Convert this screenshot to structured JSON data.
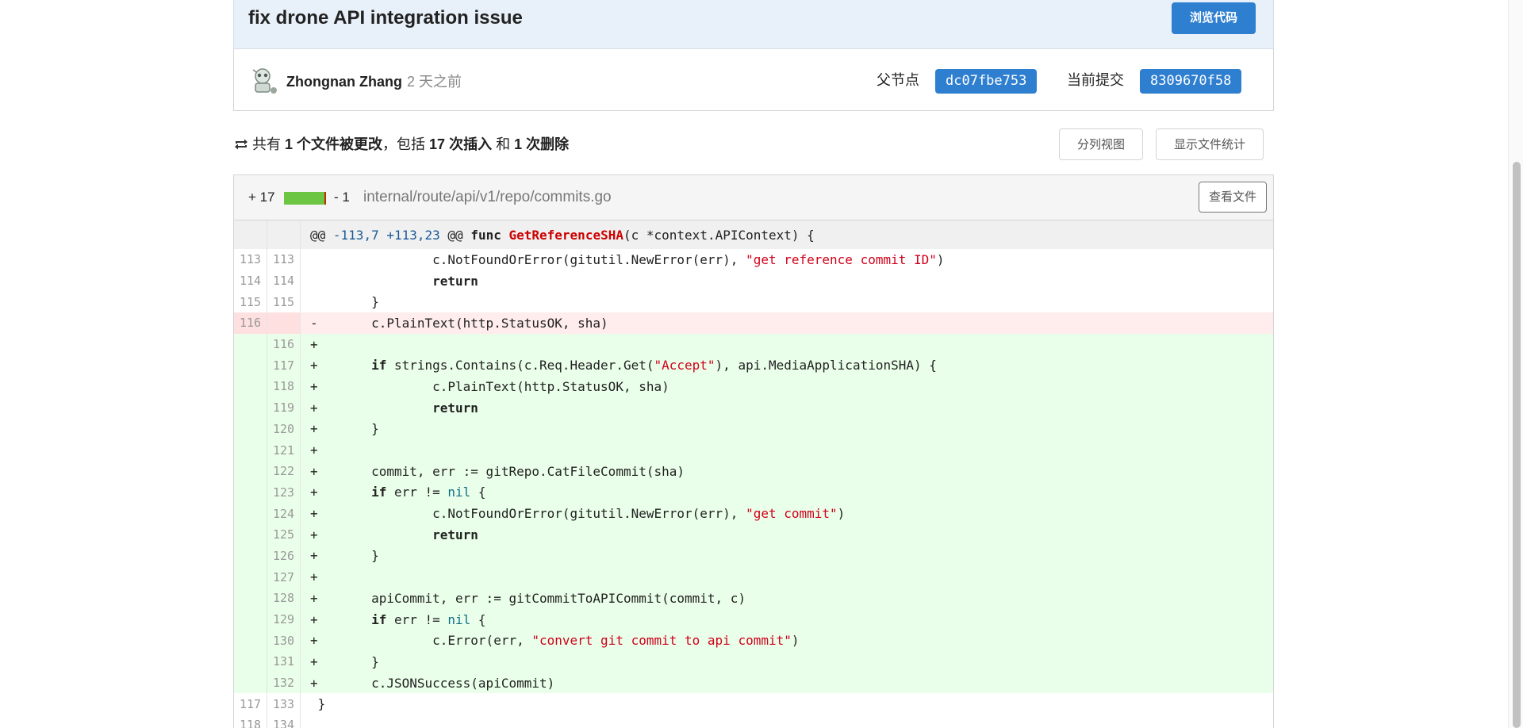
{
  "commit": {
    "title": "fix drone API integration issue",
    "browse_label": "浏览代码",
    "author": "Zhongnan Zhang",
    "time": "2 天之前",
    "parent_label": "父节点",
    "parent_sha": "dc07fbe753",
    "current_label": "当前提交",
    "current_sha": "8309670f58"
  },
  "summary": {
    "p1": "共有 ",
    "files": "1 个文件被更改",
    "p2": "，包括 ",
    "insertions": "17 次插入",
    "p3": " 和 ",
    "deletions": "1 次删除",
    "split_view_label": "分列视图",
    "show_stats_label": "显示文件统计"
  },
  "file": {
    "additions": "+ 17",
    "deletions": "- 1",
    "path": "internal/route/api/v1/repo/commits.go",
    "view_file_label": "查看文件",
    "colors": {
      "add": "#6cc644",
      "del": "#bd2c00"
    }
  },
  "hunk": {
    "text": "@@ -113,7 +113,23 @@ func GetReferenceSHA(c *context.APIContext) {"
  },
  "rows": [
    {
      "old": "113",
      "new": "113",
      "type": "ctx",
      "code": "                c.NotFoundOrError(gitutil.NewError(err), \"get reference commit ID\")"
    },
    {
      "old": "114",
      "new": "114",
      "type": "ctx",
      "code": "                return"
    },
    {
      "old": "115",
      "new": "115",
      "type": "ctx",
      "code": "        }"
    },
    {
      "old": "116",
      "new": "",
      "type": "del",
      "code": "-       c.PlainText(http.StatusOK, sha)"
    },
    {
      "old": "",
      "new": "116",
      "type": "add",
      "code": "+"
    },
    {
      "old": "",
      "new": "117",
      "type": "add",
      "code": "+       if strings.Contains(c.Req.Header.Get(\"Accept\"), api.MediaApplicationSHA) {"
    },
    {
      "old": "",
      "new": "118",
      "type": "add",
      "code": "+               c.PlainText(http.StatusOK, sha)"
    },
    {
      "old": "",
      "new": "119",
      "type": "add",
      "code": "+               return"
    },
    {
      "old": "",
      "new": "120",
      "type": "add",
      "code": "+       }"
    },
    {
      "old": "",
      "new": "121",
      "type": "add",
      "code": "+"
    },
    {
      "old": "",
      "new": "122",
      "type": "add",
      "code": "+       commit, err := gitRepo.CatFileCommit(sha)"
    },
    {
      "old": "",
      "new": "123",
      "type": "add",
      "code": "+       if err != nil {"
    },
    {
      "old": "",
      "new": "124",
      "type": "add",
      "code": "+               c.NotFoundOrError(gitutil.NewError(err), \"get commit\")"
    },
    {
      "old": "",
      "new": "125",
      "type": "add",
      "code": "+               return"
    },
    {
      "old": "",
      "new": "126",
      "type": "add",
      "code": "+       }"
    },
    {
      "old": "",
      "new": "127",
      "type": "add",
      "code": "+"
    },
    {
      "old": "",
      "new": "128",
      "type": "add",
      "code": "+       apiCommit, err := gitCommitToAPICommit(commit, c)"
    },
    {
      "old": "",
      "new": "129",
      "type": "add",
      "code": "+       if err != nil {"
    },
    {
      "old": "",
      "new": "130",
      "type": "add",
      "code": "+               c.Error(err, \"convert git commit to api commit\")"
    },
    {
      "old": "",
      "new": "131",
      "type": "add",
      "code": "+       }"
    },
    {
      "old": "",
      "new": "132",
      "type": "add",
      "code": "+       c.JSONSuccess(apiCommit)"
    },
    {
      "old": "117",
      "new": "133",
      "type": "ctx",
      "code": " }"
    },
    {
      "old": "118",
      "new": "134",
      "type": "ctx",
      "code": ""
    }
  ],
  "icons": {
    "avatar": "avatar-icon",
    "sync": "sync-icon"
  }
}
